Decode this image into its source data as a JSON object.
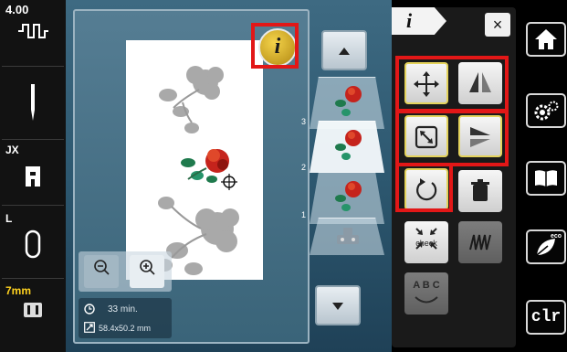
{
  "left_status": {
    "stitch_width": "4.00",
    "presser_foot_label": "JX",
    "stitch_plate_label": "L",
    "hoop_label": "7mm"
  },
  "layers": {
    "numbers": [
      "3",
      "2",
      "1"
    ]
  },
  "stats": {
    "time": "33 min.",
    "size": "58.4x50.2 mm"
  },
  "panel": {
    "tab_label": "i",
    "close": "×",
    "check_label": "check",
    "abc_label": "A B C"
  },
  "right_rail": {
    "clr_label": "clr",
    "eco_label": "eco"
  },
  "colors": {
    "highlight": "#e21717",
    "accent_yellow": "#e4d35c",
    "stage_blue": "#2d5870"
  }
}
